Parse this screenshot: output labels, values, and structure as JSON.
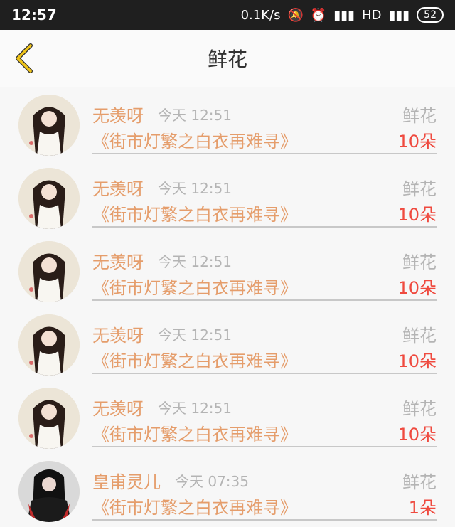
{
  "status": {
    "time": "12:57",
    "speed": "0.1K/s",
    "battery": "52"
  },
  "header": {
    "title": "鲜花"
  },
  "rows": [
    {
      "name": "无羡呀",
      "time": "今天 12:51",
      "gift": "鲜花",
      "book": "《街市灯繁之白衣再难寻》",
      "count": "10朵"
    },
    {
      "name": "无羡呀",
      "time": "今天 12:51",
      "gift": "鲜花",
      "book": "《街市灯繁之白衣再难寻》",
      "count": "10朵"
    },
    {
      "name": "无羡呀",
      "time": "今天 12:51",
      "gift": "鲜花",
      "book": "《街市灯繁之白衣再难寻》",
      "count": "10朵"
    },
    {
      "name": "无羡呀",
      "time": "今天 12:51",
      "gift": "鲜花",
      "book": "《街市灯繁之白衣再难寻》",
      "count": "10朵"
    },
    {
      "name": "无羡呀",
      "time": "今天 12:51",
      "gift": "鲜花",
      "book": "《街市灯繁之白衣再难寻》",
      "count": "10朵"
    },
    {
      "name": "皇甫灵儿",
      "time": "今天 07:35",
      "gift": "鲜花",
      "book": "《街市灯繁之白衣再难寻》",
      "count": "1朵"
    }
  ]
}
